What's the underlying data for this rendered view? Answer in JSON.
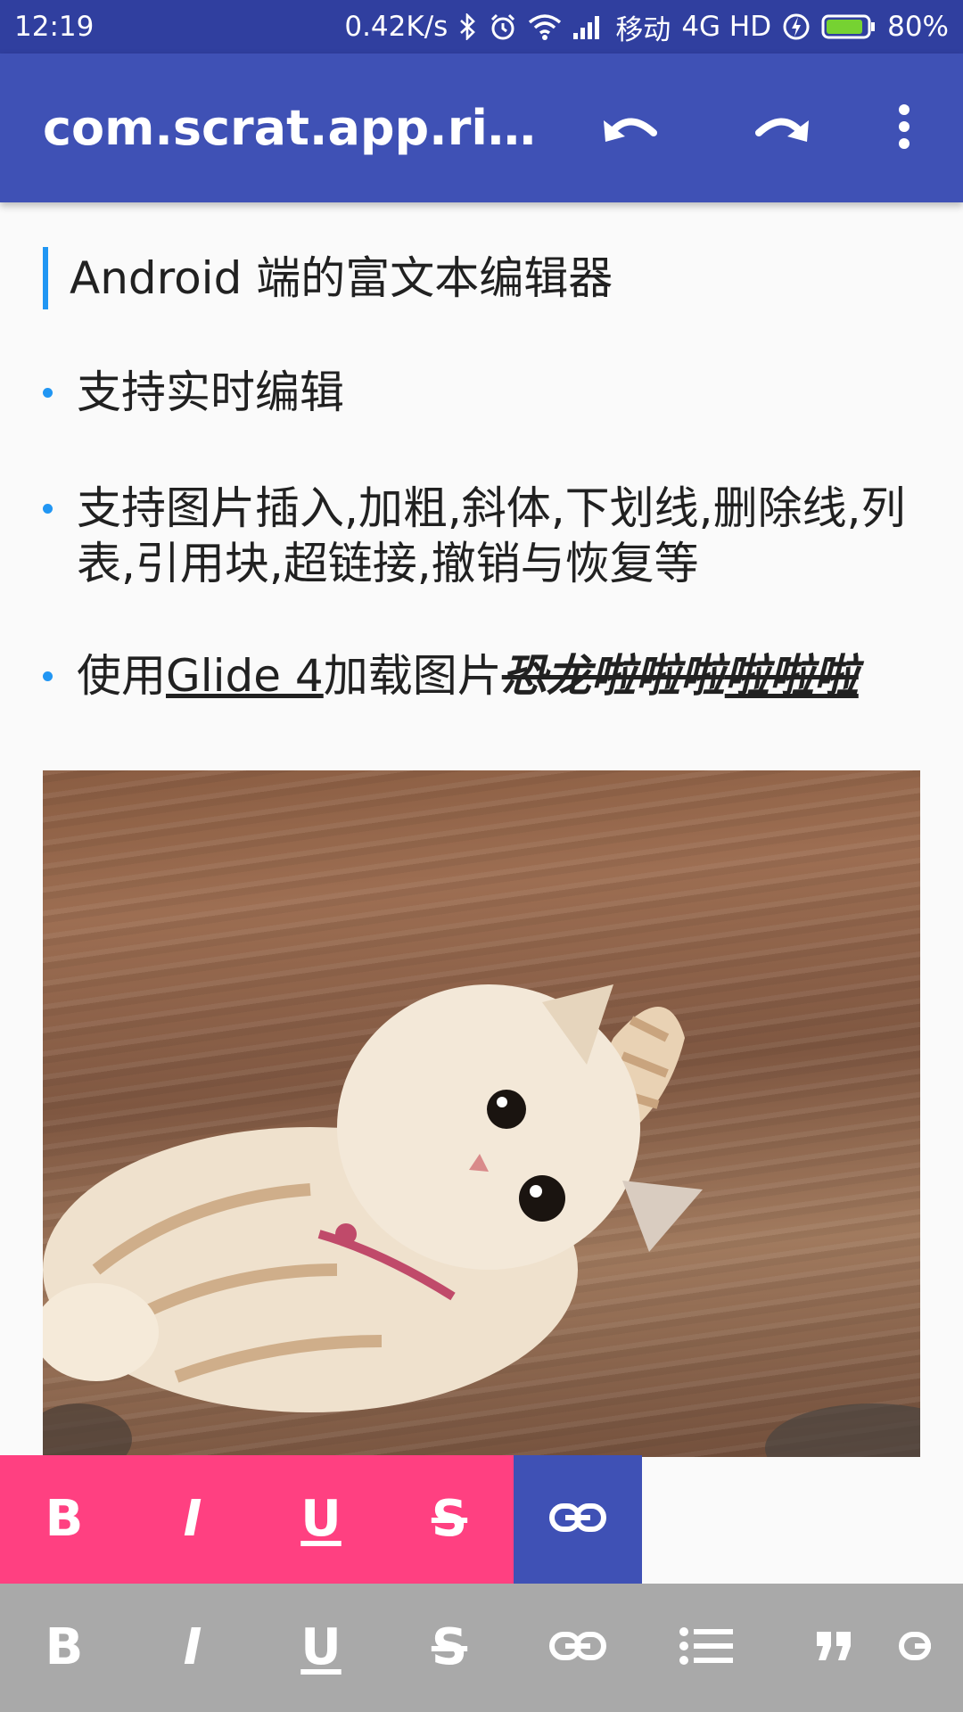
{
  "status_bar": {
    "time": "12:19",
    "speed": "0.42K/s",
    "carrier": "移动",
    "network": "4G HD",
    "battery": "80%",
    "battery_level": 0.8
  },
  "app_bar": {
    "title": "com.scrat.app.rich...",
    "icons": [
      "undo-icon",
      "redo-icon",
      "more-vert-icon"
    ]
  },
  "editor": {
    "quote": "Android 端的富文本编辑器",
    "bullet1": "支持实时编辑",
    "bullet2": "支持图片插入,加粗,斜体,下划线,删除线,列表,引用块,超链接,撤销与恢复等",
    "bullet3": {
      "prefix": "使用",
      "link": "Glide 4",
      "middle": "加载图片",
      "styled": "恐龙啦啦啦",
      "styled_underlined": "啦啦啦"
    },
    "image_alt": "cat-photo"
  },
  "popup_toolbar": {
    "bold": "B",
    "italic": "I",
    "underline": "U",
    "strike": "S"
  },
  "bottom_toolbar": {
    "bold": "B",
    "italic": "I",
    "underline": "U",
    "strike": "S"
  },
  "colors": {
    "status_bar": "#303f9f",
    "app_bar": "#3f51b5",
    "accent": "#ff4081",
    "bullet": "#2196f3",
    "bottom_bar": "#a9a9a9"
  }
}
